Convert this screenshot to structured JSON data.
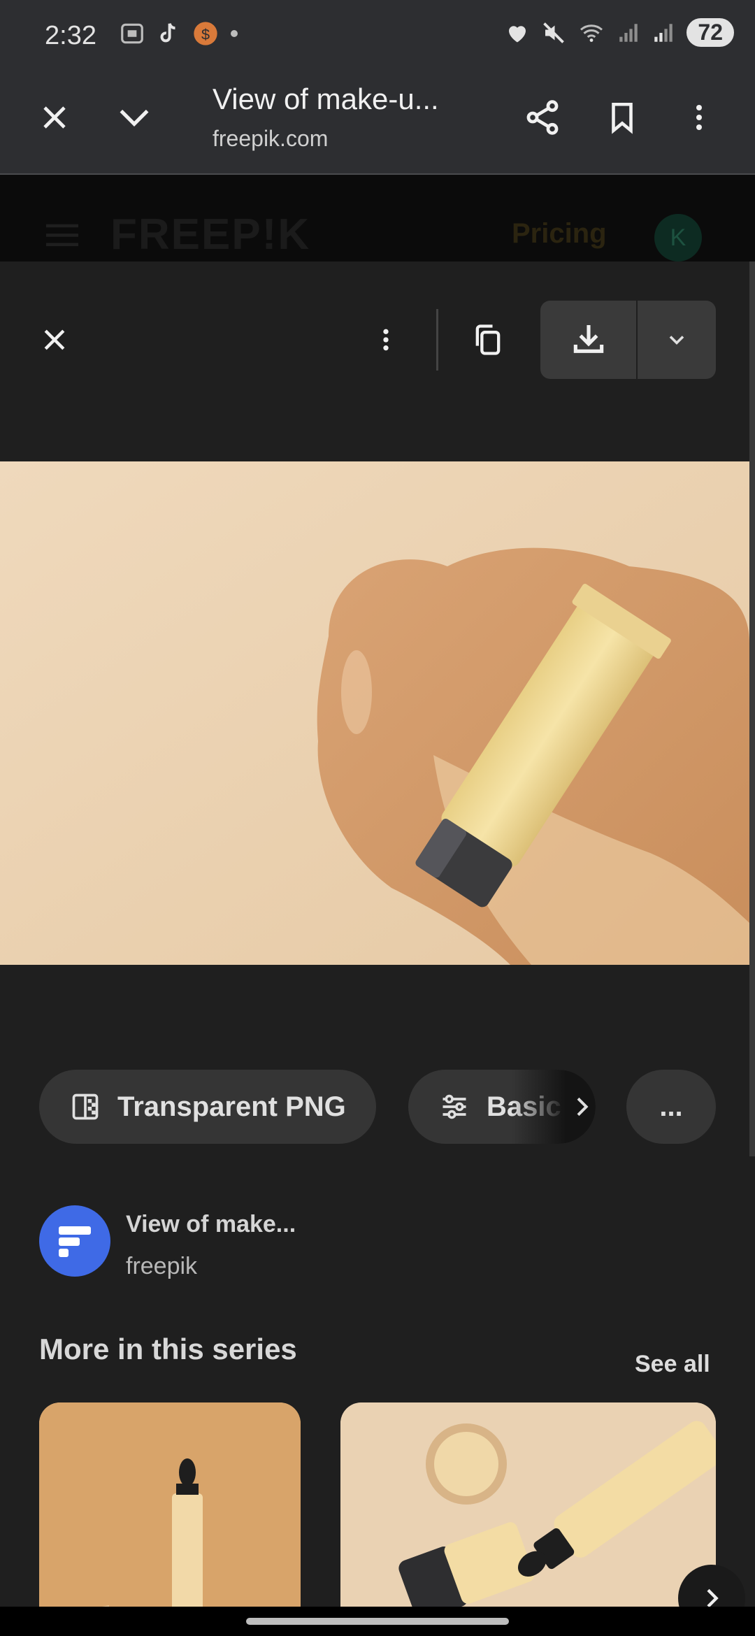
{
  "status_bar": {
    "time": "2:32",
    "battery": "72"
  },
  "toolbar": {
    "title": "View of make-u...",
    "url": "freepik.com"
  },
  "freepik_header": {
    "logo": "FREEP!K",
    "pricing": "Pricing",
    "avatar_letter": "K"
  },
  "chips": {
    "transparent_png": "Transparent PNG",
    "basic": "Basic",
    "more": "..."
  },
  "source": {
    "title": "View of make...",
    "site": "freepik"
  },
  "series": {
    "title": "More in this series",
    "see_all": "See all"
  },
  "colors": {
    "background": "#1f1f1f",
    "toolbar": "#2d2e31",
    "chip": "#353535",
    "source_avatar": "#3f6ae6",
    "photo_bg": "#ecd3b2"
  }
}
